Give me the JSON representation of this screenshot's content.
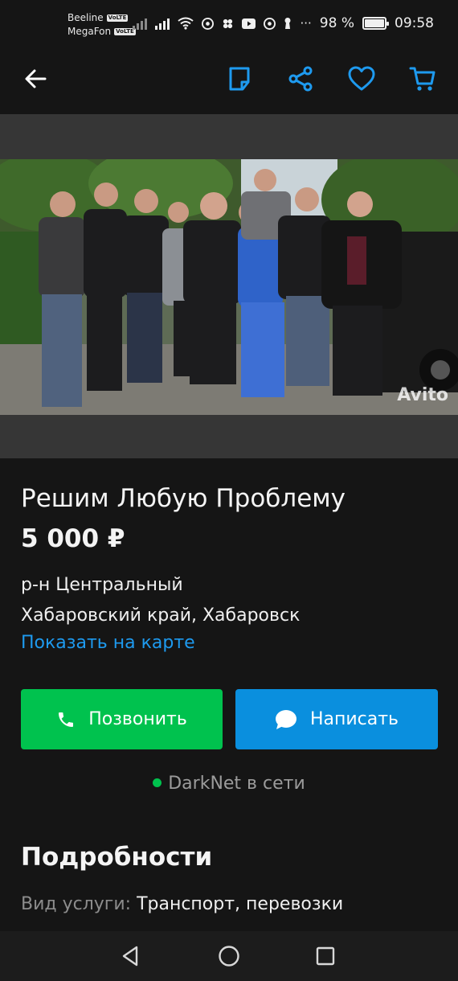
{
  "status_bar": {
    "carrier_1": "Beeline",
    "carrier_2": "MegaFon",
    "volte_badge": "VoLTE",
    "ellipsis": "···",
    "battery_percent": "98 %",
    "battery_level": 0.98,
    "time": "09:58"
  },
  "app_bar": {
    "icons": [
      "arrow-left-icon",
      "note-icon",
      "share-icon",
      "heart-icon",
      "cart-icon"
    ],
    "accent_color": "#1e9aef"
  },
  "gallery": {
    "watermark": "Avito"
  },
  "listing": {
    "title": "Решим Любую Проблему",
    "price": "5 000 ₽",
    "district": "р-н Центральный",
    "region": "Хабаровский край, Хабаровск",
    "map_link": "Показать на карте"
  },
  "actions": {
    "call_label": "Позвонить",
    "write_label": "Написать",
    "call_color": "#00c24e",
    "write_color": "#0a8fde"
  },
  "seller": {
    "status": "DarkNet в сети"
  },
  "details": {
    "heading": "Подробности",
    "rows": [
      {
        "key": "Вид услуги:",
        "value": "Транспорт, перевозки"
      }
    ]
  },
  "nav_bar": {
    "icons": [
      "back-triangle-icon",
      "home-circle-icon",
      "recents-square-icon"
    ]
  }
}
